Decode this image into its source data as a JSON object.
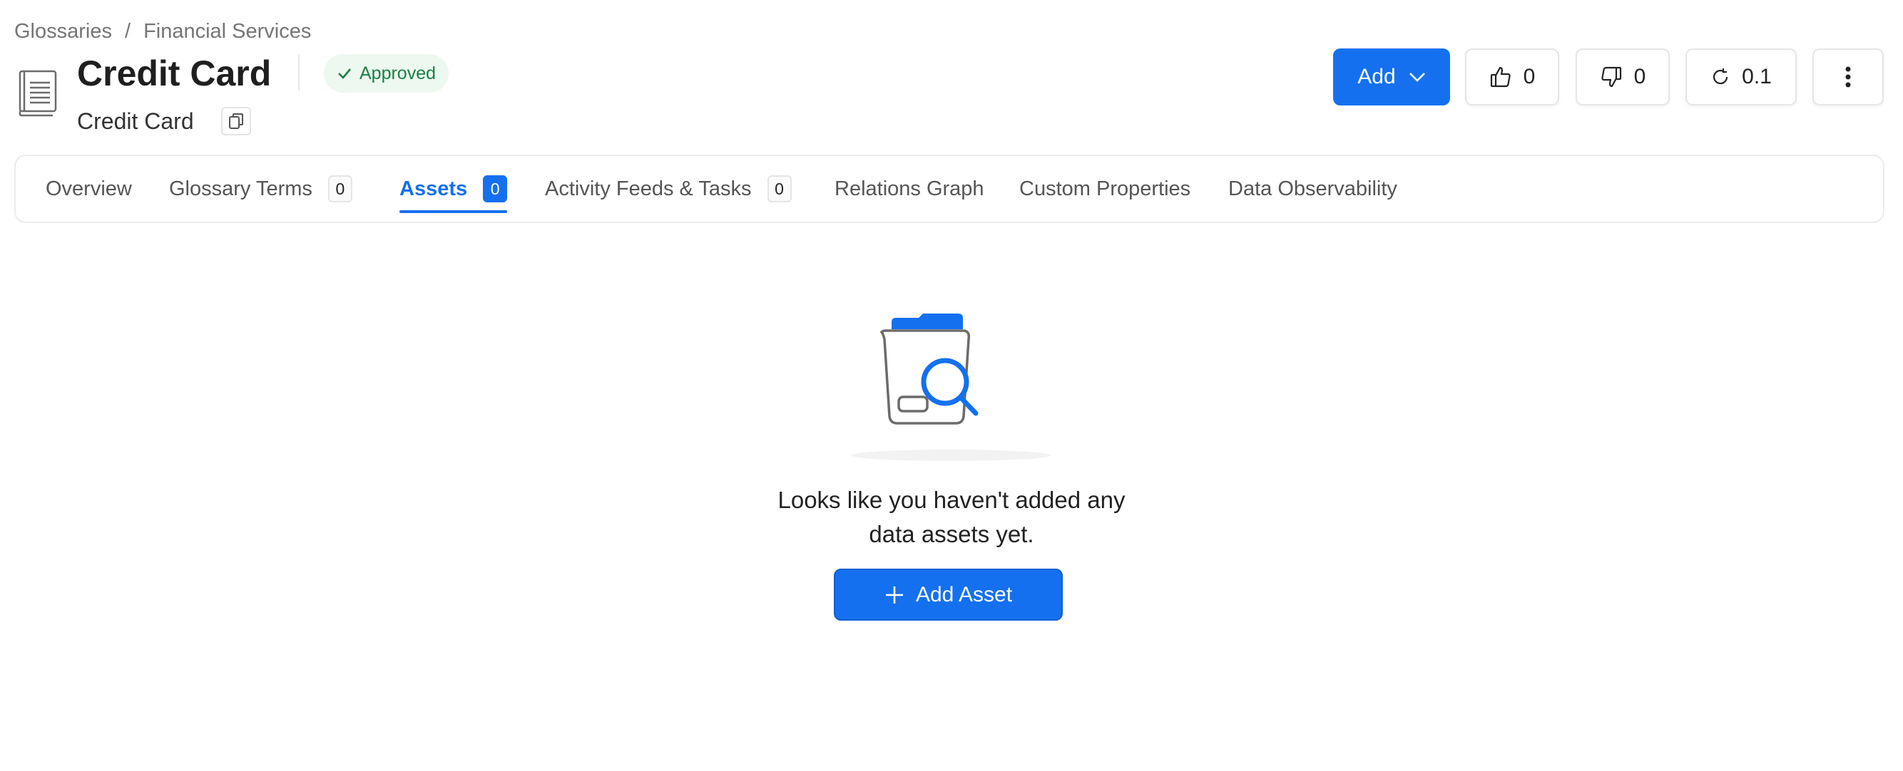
{
  "breadcrumb": {
    "items": [
      "Glossaries",
      "Financial Services"
    ],
    "separator": "/"
  },
  "header": {
    "icon": "glossary-book-icon",
    "title": "Credit Card",
    "status": "Approved",
    "display_name": "Credit Card"
  },
  "actions": {
    "add_label": "Add",
    "likes": "0",
    "dislikes": "0",
    "version": "0.1"
  },
  "tabs": [
    {
      "label": "Overview"
    },
    {
      "label": "Glossary Terms",
      "count": "0"
    },
    {
      "label": "Assets",
      "count": "0",
      "active": true
    },
    {
      "label": "Activity Feeds & Tasks",
      "count": "0"
    },
    {
      "label": "Relations Graph"
    },
    {
      "label": "Custom Properties"
    },
    {
      "label": "Data Observability"
    }
  ],
  "empty_state": {
    "line1": "Looks like you haven't added any",
    "line2": "data assets yet.",
    "button_label": "Add Asset"
  },
  "colors": {
    "primary": "#1570ef",
    "approved_bg": "#ecf8f0",
    "approved_text": "#1b7f47"
  }
}
